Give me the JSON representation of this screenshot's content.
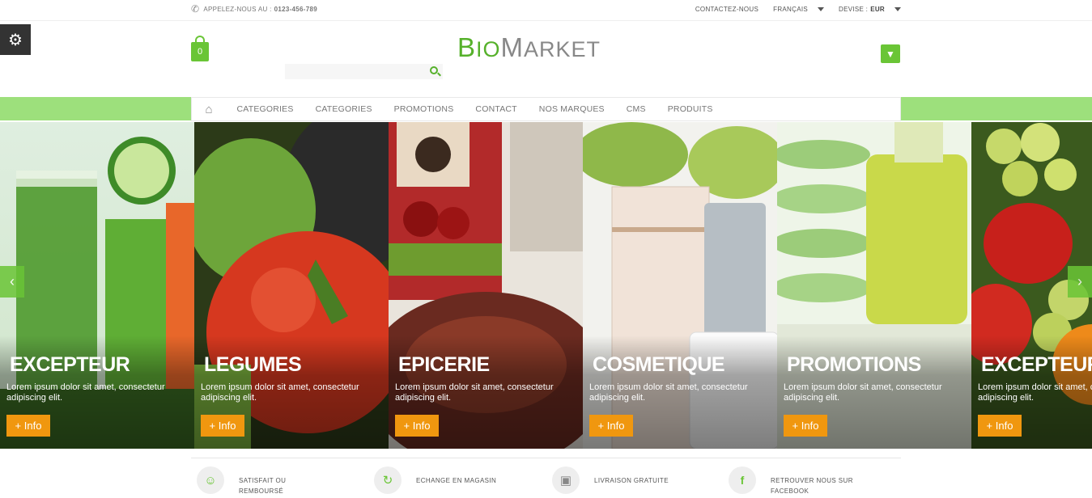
{
  "topbar": {
    "phone_label": "APPELEZ-NOUS AU :",
    "phone_number": "0123-456-789",
    "contact": "CONTACTEZ-NOUS",
    "language": "FRANÇAIS",
    "currency_label": "DEVISE :",
    "currency_value": "EUR"
  },
  "header": {
    "logo_b": "B",
    "logo_io": "IO",
    "logo_m": "M",
    "logo_arket": "ARKET",
    "cart_count": "0",
    "search_placeholder": ""
  },
  "nav": {
    "items": [
      "CATEGORIES",
      "CATEGORIES",
      "PROMOTIONS",
      "CONTACT",
      "NOS MARQUES",
      "CMS",
      "PRODUITS"
    ]
  },
  "slides": [
    {
      "title": "EXCEPTEUR",
      "desc": "Lorem ipsum dolor sit amet, consectetur adipiscing elit.",
      "button": "+ Info"
    },
    {
      "title": "LEGUMES",
      "desc": "Lorem ipsum dolor sit amet, consectetur adipiscing elit.",
      "button": "+ Info"
    },
    {
      "title": "EPICERIE",
      "desc": "Lorem ipsum dolor sit amet, consectetur adipiscing elit.",
      "button": "+ Info"
    },
    {
      "title": "COSMETIQUE",
      "desc": "Lorem ipsum dolor sit amet, consectetur adipiscing elit.",
      "button": "+ Info"
    },
    {
      "title": "PROMOTIONS",
      "desc": "Lorem ipsum dolor sit amet, consectetur adipiscing elit.",
      "button": "+ Info"
    },
    {
      "title": "EXCEPTEUR",
      "desc": "Lorem ipsum dolor sit amet, consectetur adipiscing elit.",
      "button": "+ Info"
    }
  ],
  "features": [
    {
      "label": "SATISFAIT OU REMBOURSÉ",
      "icon": "smile-icon"
    },
    {
      "label": "ECHANGE EN MAGASIN",
      "icon": "refresh-icon"
    },
    {
      "label": "LIVRAISON GRATUITE",
      "icon": "truck-icon"
    },
    {
      "label": "RETROUVER NOUS SUR FACEBOOK",
      "icon": "facebook-icon"
    }
  ],
  "colors": {
    "brand_green": "#6ac536",
    "nav_band": "#9de07c",
    "info_button": "#f0970f"
  }
}
